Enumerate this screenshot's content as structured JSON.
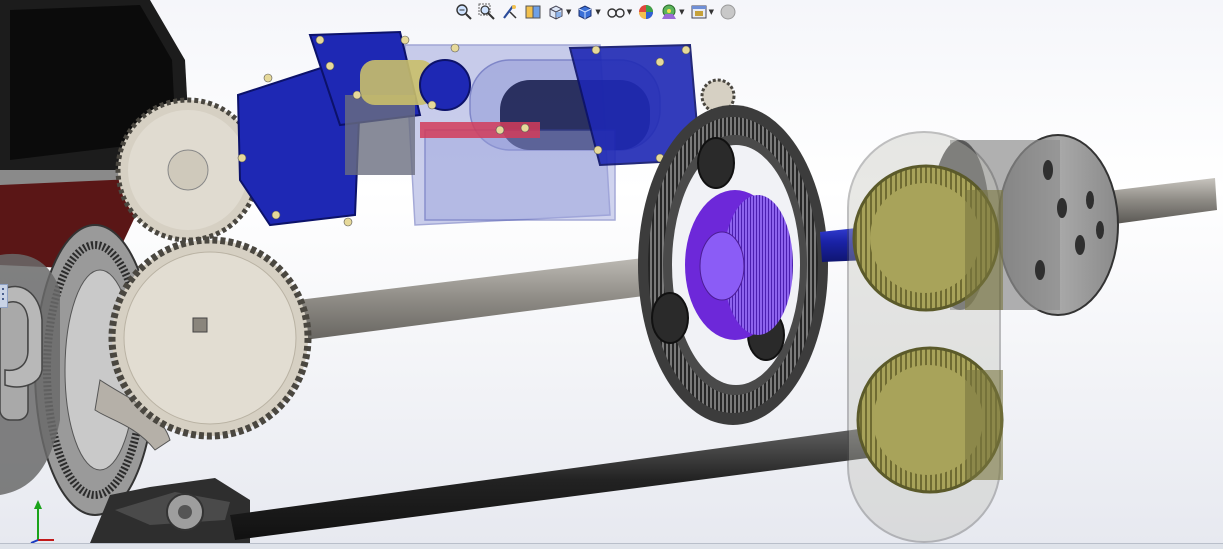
{
  "heads_up_toolbar": [
    {
      "id": "zoom-to-fit",
      "icon": "zoom-to-fit-icon",
      "dropdown": false
    },
    {
      "id": "zoom-to-area",
      "icon": "zoom-to-area-icon",
      "dropdown": false
    },
    {
      "id": "previous-view",
      "icon": "previous-view-icon",
      "dropdown": false
    },
    {
      "id": "section-view",
      "icon": "section-view-icon",
      "dropdown": false
    },
    {
      "id": "view-orientation",
      "icon": "view-orientation-icon",
      "dropdown": true
    },
    {
      "id": "display-style",
      "icon": "display-style-icon",
      "dropdown": true
    },
    {
      "id": "hide-show-items",
      "icon": "hide-show-items-icon",
      "dropdown": true
    },
    {
      "id": "edit-appearance",
      "icon": "edit-appearance-icon",
      "dropdown": false
    },
    {
      "id": "apply-scene",
      "icon": "apply-scene-icon",
      "dropdown": true
    },
    {
      "id": "view-settings",
      "icon": "view-settings-icon",
      "dropdown": true
    },
    {
      "id": "render-tools",
      "icon": "render-tools-icon",
      "dropdown": false
    }
  ],
  "colors": {
    "shaft_gray": "#8f8c86",
    "gear_beige": "#d6d0c3",
    "motor_blue": "#1e28b4",
    "housing_translucent": "#8c95d6",
    "gear_olive": "#a8a35a",
    "ring_dark": "#3c3c3c",
    "planet_carrier": "#6d28d9",
    "viewport_bg": "#f2f3f7"
  },
  "status_bar": {
    "left_text": "",
    "right_text": ""
  }
}
